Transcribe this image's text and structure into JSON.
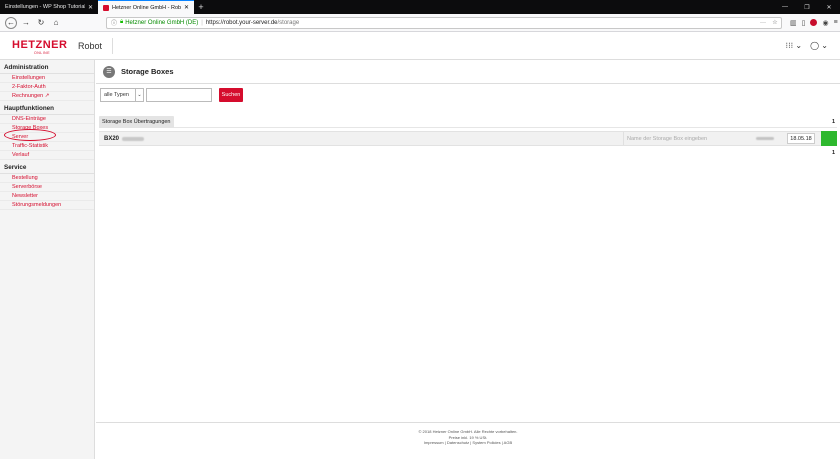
{
  "browser": {
    "tabs": [
      {
        "title": "Einstellungen - WP Shop Tutorial - ..."
      },
      {
        "title": "Hetzner Online GmbH - Robot"
      }
    ],
    "url": {
      "secure_label": "Hetzner Online GmbH (DE)",
      "host": "https://robot.your-server.de",
      "path": "/storage"
    }
  },
  "header": {
    "logo_text": "HETZNER",
    "logo_sub": "ONLINE",
    "app_name": "Robot"
  },
  "sidebar": {
    "sections": [
      {
        "title": "Administration",
        "items": [
          "Einstellungen",
          "2-Faktor-Auth",
          "Rechnungen"
        ]
      },
      {
        "title": "Hauptfunktionen",
        "items": [
          "DNS-Einträge",
          "Storage Boxes",
          "Server",
          "Traffic-Statistik",
          "Verlauf"
        ]
      },
      {
        "title": "Service",
        "items": [
          "Bestellung",
          "Serverbörse",
          "Newsletter",
          "Störungsmeldungen"
        ]
      }
    ]
  },
  "main": {
    "title": "Storage Boxes",
    "filter": {
      "type_select": "alle Typen",
      "search_button": "Suchen"
    },
    "transfer_header": "Storage Box Übertragungen",
    "page_top": "1",
    "page_bottom": "1",
    "rows": [
      {
        "product": "BX20",
        "name_placeholder": "Name der Storage Box eingeben",
        "date": "18.05.18"
      }
    ]
  },
  "footer": {
    "line1": "© 2018 Hetzner Online GmbH. Alle Rechte vorbehalten.",
    "line2": "Preise inkl. 19 % USt.",
    "line3": "Impressum | Datenschutz | System Policies | AGB"
  },
  "colors": {
    "brand_red": "#d50c2d",
    "status_green": "#2eb82e"
  }
}
